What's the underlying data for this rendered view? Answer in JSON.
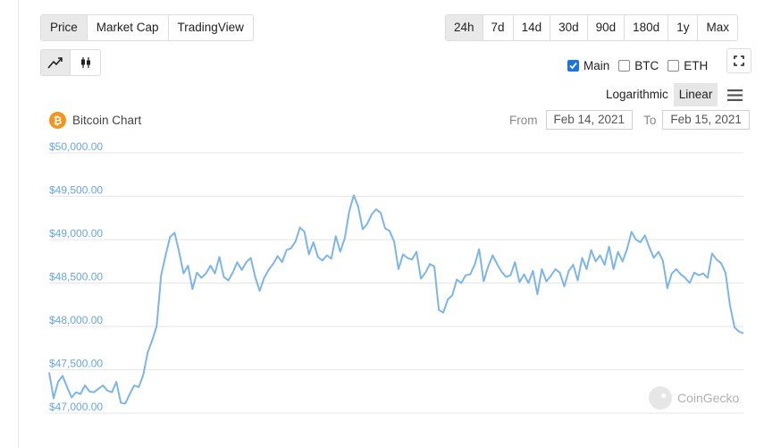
{
  "tabs": [
    {
      "label": "Price",
      "active": true
    },
    {
      "label": "Market Cap",
      "active": false
    },
    {
      "label": "TradingView",
      "active": false
    }
  ],
  "ranges": [
    {
      "label": "24h",
      "active": true
    },
    {
      "label": "7d",
      "active": false
    },
    {
      "label": "14d",
      "active": false
    },
    {
      "label": "30d",
      "active": false
    },
    {
      "label": "90d",
      "active": false
    },
    {
      "label": "180d",
      "active": false
    },
    {
      "label": "1y",
      "active": false
    },
    {
      "label": "Max",
      "active": false
    }
  ],
  "chart_types": [
    {
      "icon": "line-chart-icon",
      "active": true
    },
    {
      "icon": "candlestick-icon",
      "active": false
    }
  ],
  "compare": [
    {
      "label": "Main",
      "checked": true
    },
    {
      "label": "BTC",
      "checked": false
    },
    {
      "label": "ETH",
      "checked": false
    }
  ],
  "scale": {
    "logarithmic": "Logarithmic",
    "linear": "Linear",
    "active": "linear"
  },
  "chart_title": "Bitcoin Chart",
  "date_range": {
    "from_label": "From",
    "from": "Feb 14, 2021",
    "to_label": "To",
    "to": "Feb 15, 2021"
  },
  "watermark": "CoinGecko",
  "colors": {
    "line": "#7db5e8",
    "axis_label": "#6aa6de",
    "grid": "#e6e6e6",
    "bitcoin": "#f7931a"
  },
  "chart_data": {
    "type": "line",
    "title": "Bitcoin Chart",
    "xlabel": "",
    "ylabel": "",
    "ylim": [
      47000,
      50000
    ],
    "y_ticks": [
      "$47,000.00",
      "$47,500.00",
      "$48,000.00",
      "$48,500.00",
      "$49,000.00",
      "$49,500.00",
      "$50,000.00"
    ],
    "y_tick_values": [
      47000,
      47500,
      48000,
      48500,
      49000,
      49500,
      50000
    ],
    "grid": true,
    "series": [
      {
        "values": [
          47470,
          47170,
          47360,
          47430,
          47300,
          47180,
          47240,
          47220,
          47320,
          47250,
          47240,
          47280,
          47320,
          47260,
          47240,
          47360,
          47120,
          47110,
          47220,
          47320,
          47300,
          47440,
          47700,
          47840,
          48000,
          48590,
          48820,
          49030,
          49080,
          48860,
          48610,
          48700,
          48430,
          48620,
          48560,
          48610,
          48700,
          48610,
          48800,
          48570,
          48530,
          48620,
          48740,
          48650,
          48740,
          48790,
          48570,
          48410,
          48560,
          48650,
          48720,
          48810,
          48740,
          48880,
          48900,
          48980,
          49140,
          49090,
          48830,
          48970,
          48800,
          48760,
          48820,
          48780,
          49040,
          48860,
          49020,
          49330,
          49510,
          49380,
          49120,
          49180,
          49290,
          49350,
          49310,
          49130,
          49100,
          48980,
          48660,
          48830,
          48790,
          48770,
          48860,
          48550,
          48620,
          48720,
          48690,
          48190,
          48160,
          48310,
          48360,
          48540,
          48500,
          48590,
          48600,
          48710,
          48890,
          48520,
          48690,
          48820,
          48720,
          48630,
          48570,
          48590,
          48740,
          48510,
          48600,
          48500,
          48640,
          48370,
          48660,
          48520,
          48580,
          48660,
          48620,
          48460,
          48640,
          48710,
          48530,
          48790,
          48660,
          48880,
          48750,
          48820,
          48710,
          48920,
          48660,
          48860,
          48750,
          48890,
          49090,
          49000,
          48970,
          49050,
          48910,
          48790,
          48860,
          48760,
          48440,
          48610,
          48660,
          48600,
          48560,
          48500,
          48620,
          48590,
          48610,
          48560,
          48840,
          48770,
          48730,
          48620,
          48240,
          47990,
          47940,
          47920
        ]
      }
    ]
  }
}
